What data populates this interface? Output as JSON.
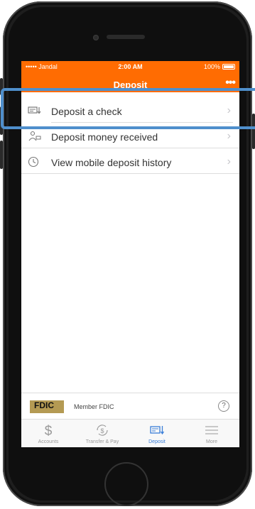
{
  "status_bar": {
    "carrier": "••••• Jandal",
    "time": "2:00 AM",
    "battery": "100%"
  },
  "nav": {
    "title": "Deposit",
    "more": "•••"
  },
  "menu": [
    {
      "label": "Deposit a check",
      "icon": "check-deposit-icon"
    },
    {
      "label": "Deposit money received",
      "icon": "money-received-icon"
    },
    {
      "label": "View mobile deposit history",
      "icon": "history-clock-icon"
    }
  ],
  "footer": {
    "fdic_logo": "FDIC",
    "member": "Member FDIC",
    "help": "?"
  },
  "tabs": [
    {
      "label": "Accounts",
      "icon": "dollar-icon"
    },
    {
      "label": "Transfer & Pay",
      "icon": "transfer-pay-icon"
    },
    {
      "label": "Deposit",
      "icon": "deposit-icon",
      "active": true
    },
    {
      "label": "More",
      "icon": "menu-lines-icon"
    }
  ],
  "colors": {
    "brand": "#ff6c02",
    "active_tab": "#3a7ed8",
    "highlight": "#4f8fcc"
  }
}
